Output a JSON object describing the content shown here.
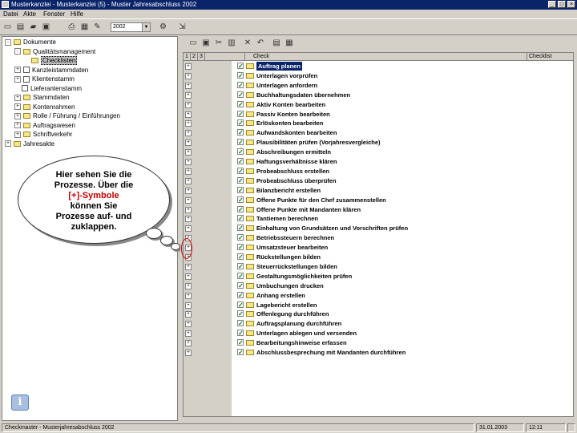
{
  "window": {
    "title": "Musterkanzlei - Musterkanzlei (5) - Muster Jahresabschluss 2002"
  },
  "menu": [
    "Datei",
    "Akte",
    "Fenster",
    "Hilfe"
  ],
  "toolbar": {
    "year_value": "2002"
  },
  "tree": [
    {
      "label": "Dokumente",
      "level": 0,
      "expander": "-",
      "icon": "folder"
    },
    {
      "label": "Qualitätsmanagement",
      "level": 1,
      "expander": "-",
      "icon": "folder"
    },
    {
      "label": "Checklisten",
      "level": 2,
      "expander": "",
      "icon": "folder",
      "selected": true
    },
    {
      "label": "Kanzleistammdaten",
      "level": 1,
      "expander": "+",
      "icon": "doc"
    },
    {
      "label": "Klientenstamm",
      "level": 1,
      "expander": "+",
      "icon": "doc"
    },
    {
      "label": "Lieferantenstamm",
      "level": 1,
      "expander": "",
      "icon": "doc"
    },
    {
      "label": "Stammdaten",
      "level": 1,
      "expander": "+",
      "icon": "folder"
    },
    {
      "label": "Kontenrahmen",
      "level": 1,
      "expander": "+",
      "icon": "folder"
    },
    {
      "label": "Rolle / Führung / Einführungen",
      "level": 1,
      "expander": "+",
      "icon": "folder"
    },
    {
      "label": "Auftragswesen",
      "level": 1,
      "expander": "+",
      "icon": "folder"
    },
    {
      "label": "Schriftverkehr",
      "level": 1,
      "expander": "+",
      "icon": "folder"
    },
    {
      "label": "Jahresakte",
      "level": 0,
      "expander": "+",
      "icon": "folder"
    }
  ],
  "callout": {
    "line1": "Hier sehen Sie die",
    "line2": "Prozesse. Über die",
    "highlight": "[+]-Symbole",
    "line3": "können Sie",
    "line4": "Prozesse auf- und",
    "line5": "zuklappen."
  },
  "grid": {
    "col_levels": [
      "1",
      "2",
      "3"
    ],
    "col_check": "Check",
    "col_checklist": "Checklist",
    "rows": [
      "Auftrag planen",
      "Unterlagen vorprüfen",
      "Unterlagen anfordern",
      "Buchhaltungsdaten übernehmen",
      "Aktiv Konten bearbeiten",
      "Passiv Konten bearbeiten",
      "Erlöskonten bearbeiten",
      "Aufwandskonten bearbeiten",
      "Plausibilitäten prüfen (Vorjahresvergleiche)",
      "Abschreibungen ermitteln",
      "Haftungsverhältnisse klären",
      "Probeabschluss erstellen",
      "Probeabschluss überprüfen",
      "Bilanzbericht erstellen",
      "Offene Punkte für den Chef zusammenstellen",
      "Offene Punkte mit Mandanten klären",
      "Tantiemen berechnen",
      "Einhaltung von Grundsätzen und Vorschriften prüfen",
      "Betriebssteuern berechnen",
      "Umsatzsteuer bearbeiten",
      "Rückstellungen bilden",
      "Steuerrückstellungen bilden",
      "Gestaltungsmöglichkeiten prüfen",
      "Umbuchungen drucken",
      "Anhang erstellen",
      "Lagebericht erstellen",
      "Offenlegung durchführen",
      "Auftragsplanung durchführen",
      "Unterlagen ablegen und versenden",
      "Bearbeitungshinweise erfassen",
      "Abschlussbesprechung mit Mandanten durchführen"
    ]
  },
  "status": {
    "left": "Checkmaster - Musterjahresabschluss 2002",
    "date": "31.01.2003",
    "time": "12:11"
  }
}
